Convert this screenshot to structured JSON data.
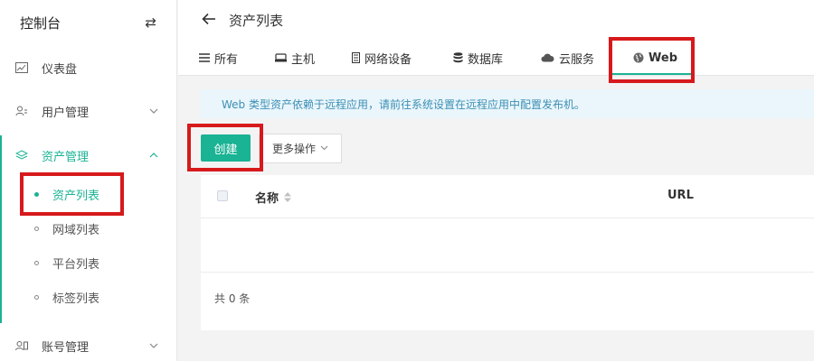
{
  "sidebar": {
    "title": "控制台",
    "switch_icon": "⇄",
    "items": [
      {
        "label": "仪表盘",
        "icon": "dashboard-icon"
      },
      {
        "label": "用户管理",
        "icon": "users-icon"
      },
      {
        "label": "资产管理",
        "icon": "layers-icon"
      },
      {
        "label": "账号管理",
        "icon": "accounts-icon"
      }
    ],
    "sub_items": [
      {
        "label": "资产列表"
      },
      {
        "label": "网域列表"
      },
      {
        "label": "平台列表"
      },
      {
        "label": "标签列表"
      }
    ]
  },
  "header": {
    "title": "资产列表",
    "tabs": [
      {
        "label": "所有",
        "icon": "list-icon"
      },
      {
        "label": "主机",
        "icon": "host-icon"
      },
      {
        "label": "网络设备",
        "icon": "network-device-icon"
      },
      {
        "label": "数据库",
        "icon": "database-icon"
      },
      {
        "label": "云服务",
        "icon": "cloud-icon"
      },
      {
        "label": "Web",
        "icon": "globe-icon"
      }
    ]
  },
  "info": {
    "text": "Web 类型资产依赖于远程应用，请前往系统设置在远程应用中配置发布机。"
  },
  "actions": {
    "create_label": "创建",
    "more_label": "更多操作"
  },
  "table": {
    "columns": [
      "名称",
      "URL"
    ],
    "rows": [],
    "total_text": "共 0 条"
  },
  "colors": {
    "accent": "#1ab394",
    "highlight": "#d7191c",
    "info_bg": "#eaf6fb",
    "info_text": "#3d8fb5"
  }
}
